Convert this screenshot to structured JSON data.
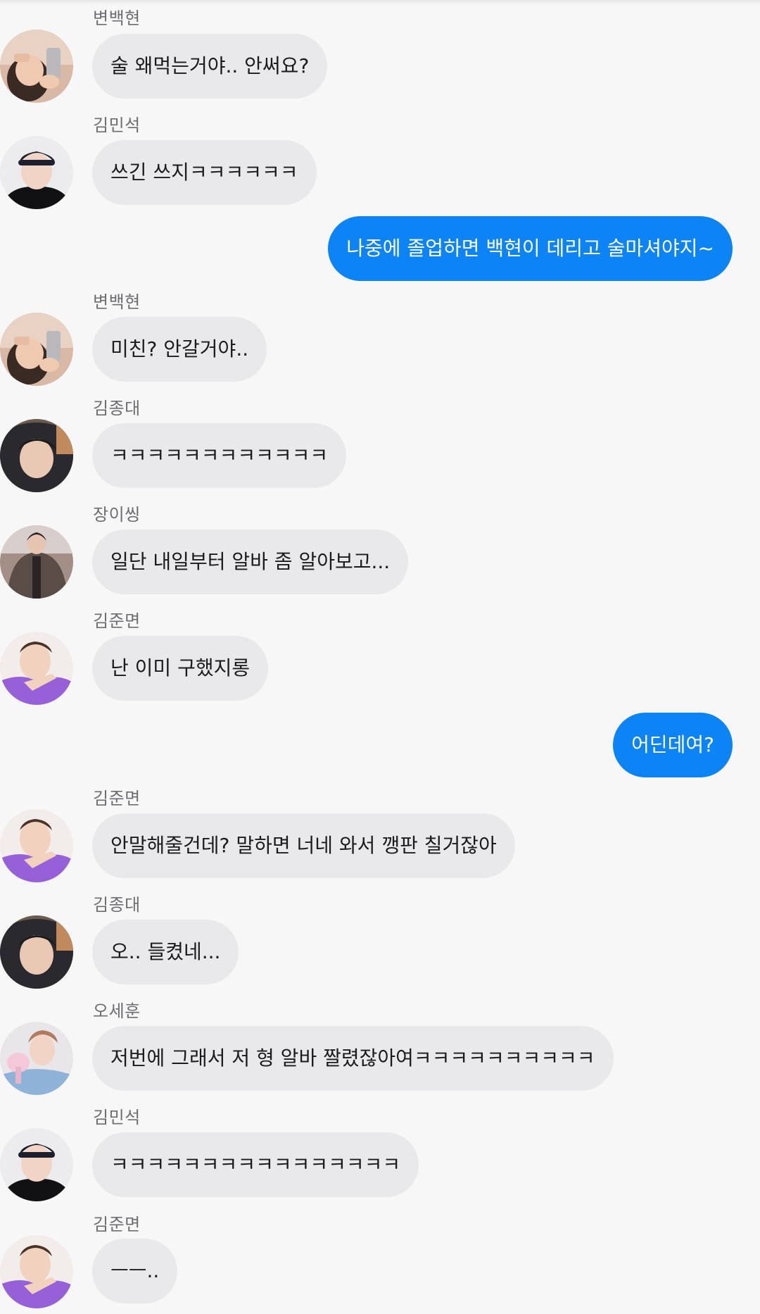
{
  "messages": [
    {
      "sender": "변백현",
      "text": "술 왜먹는거야.. 안써요?"
    },
    {
      "sender": "김민석",
      "text": "쓰긴 쓰지ㅋㅋㅋㅋㅋㅋ"
    },
    {
      "sender": "",
      "text": "나중에 졸업하면 백현이 데리고 술마셔야지~"
    },
    {
      "sender": "변백현",
      "text": "미친? 안갈거야.."
    },
    {
      "sender": "김종대",
      "text": "ㅋㅋㅋㅋㅋㅋㅋㅋㅋㅋㅋㅋ"
    },
    {
      "sender": "장이씽",
      "text": "일단 내일부터 알바 좀 알아보고..."
    },
    {
      "sender": "김준면",
      "text": "난 이미 구했지롱"
    },
    {
      "sender": "",
      "text": "어딘데여?"
    },
    {
      "sender": "김준면",
      "text": "안말해줄건데? 말하면 너네 와서 깽판 칠거잖아"
    },
    {
      "sender": "김종대",
      "text": "오.. 들켰네..."
    },
    {
      "sender": "오세훈",
      "text": "저번에 그래서 저 형 알바 짤렸잖아여ㅋㅋㅋㅋㅋㅋㅋㅋㅋㅋ"
    },
    {
      "sender": "김민석",
      "text": "ㅋㅋㅋㅋㅋㅋㅋㅋㅋㅋㅋㅋㅋㅋㅋㅋ"
    },
    {
      "sender": "김준면",
      "text": "ㅡㅡ.."
    }
  ],
  "colors": {
    "background": "#f7f7f8",
    "incoming_bubble": "#e9e9eb",
    "outgoing_bubble": "#0d84f5",
    "sender_name": "#6d6d72"
  }
}
